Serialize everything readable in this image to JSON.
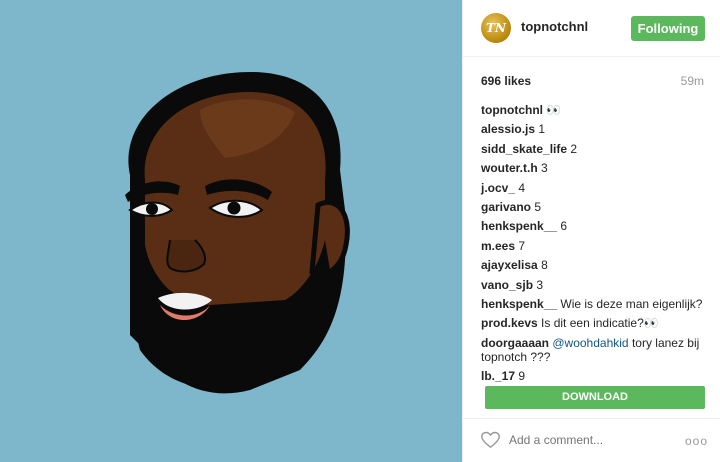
{
  "post": {
    "image_alt": "Illustrated portrait",
    "header": {
      "username": "topnotchnl",
      "avatar_initials": "TN",
      "follow_label": "Following"
    },
    "likes": "696 likes",
    "time": "59m",
    "comments": [
      {
        "user": "topnotchnl",
        "text": "👀"
      },
      {
        "user": "alessio.js",
        "text": "1"
      },
      {
        "user": "sidd_skate_life",
        "text": "2"
      },
      {
        "user": "wouter.t.h",
        "text": "3"
      },
      {
        "user": "j.ocv_",
        "text": "4"
      },
      {
        "user": "garivano",
        "text": "5"
      },
      {
        "user": "henkspenk__",
        "text": "6"
      },
      {
        "user": "m.ees",
        "text": "7"
      },
      {
        "user": "ajayxelisa",
        "text": "8"
      },
      {
        "user": "vano_sjb",
        "text": "3"
      },
      {
        "user": "henkspenk__",
        "text": "Wie is deze man eigenlijk?"
      },
      {
        "user": "prod.kevs",
        "text": "Is dit een indicatie?👀"
      },
      {
        "user": "doorgaaaan",
        "mention": "@woohdahkid",
        "text": "tory lanez bij topnotch ???"
      },
      {
        "user": "lb._17",
        "text": "9"
      }
    ],
    "download_label": "DOWNLOAD",
    "add_comment_placeholder": "Add a comment...",
    "more_label": "ooo"
  },
  "colors": {
    "art_background": "#7eb6cb",
    "accent_green": "#5cb85c",
    "skin": "#5a2e14",
    "beard": "#0a0a0a"
  },
  "icons": [
    "heart-icon",
    "more-options-icon"
  ]
}
